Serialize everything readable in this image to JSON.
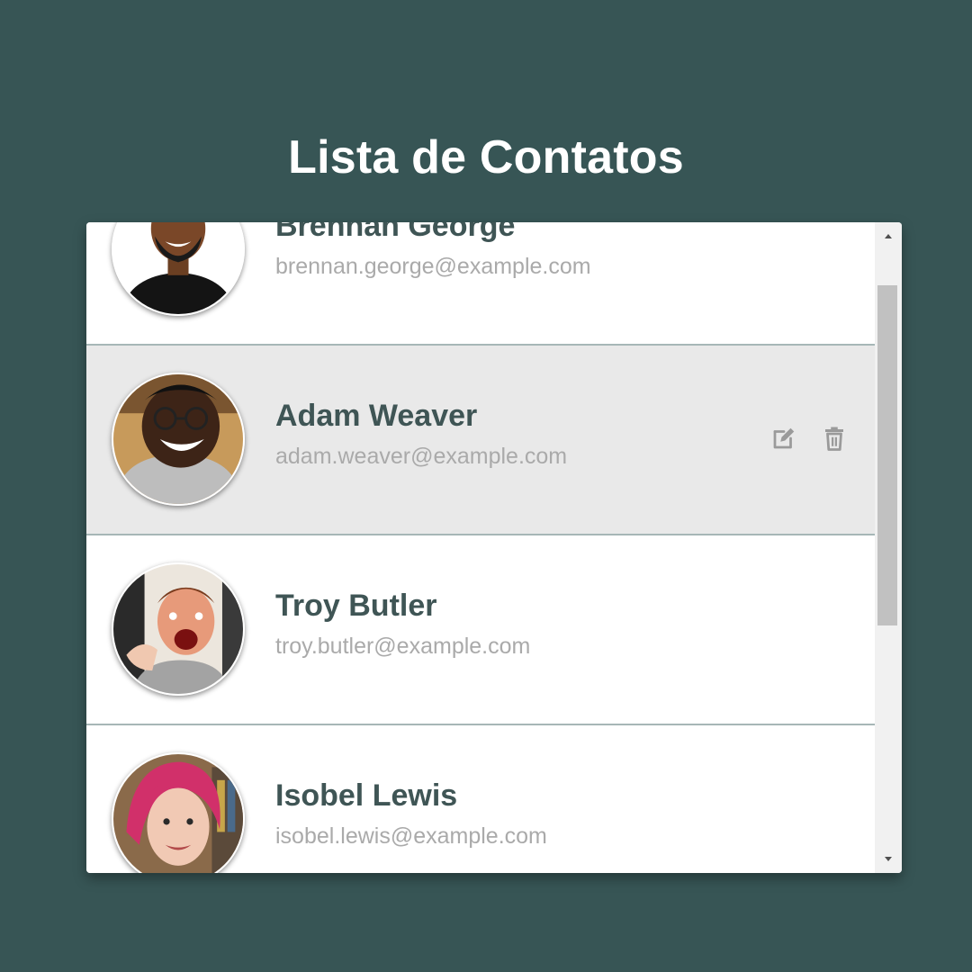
{
  "page": {
    "title": "Lista de Contatos"
  },
  "colors": {
    "background": "#375555",
    "card": "#ffffff",
    "row_hover": "#e9e9e9",
    "name_text": "#3f5555",
    "email_text": "#aaaaaa",
    "divider": "#a7b7b7",
    "icon": "#9a9a9a"
  },
  "contacts": [
    {
      "name": "Brennan George",
      "email": "brennan.george@example.com",
      "avatar_icon": "avatar-photo"
    },
    {
      "name": "Adam Weaver",
      "email": "adam.weaver@example.com",
      "avatar_icon": "avatar-photo",
      "hovered": true
    },
    {
      "name": "Troy Butler",
      "email": "troy.butler@example.com",
      "avatar_icon": "avatar-photo"
    },
    {
      "name": "Isobel Lewis",
      "email": "isobel.lewis@example.com",
      "avatar_icon": "avatar-photo"
    }
  ],
  "row_actions": {
    "edit_icon": "edit-icon",
    "delete_icon": "trash-icon"
  },
  "scrollbar": {
    "position_fraction": 0.12
  }
}
